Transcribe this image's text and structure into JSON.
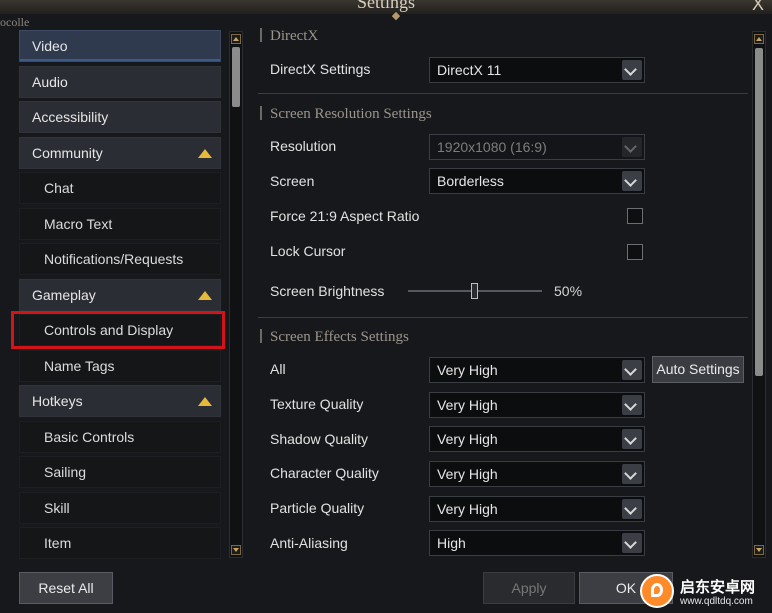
{
  "window": {
    "title": "Settings",
    "close": "X",
    "top_left_text": "ocolle"
  },
  "sidebar": {
    "items": [
      {
        "label": "Video"
      },
      {
        "label": "Audio"
      },
      {
        "label": "Accessibility"
      },
      {
        "label": "Community"
      },
      {
        "label": "Chat"
      },
      {
        "label": "Macro Text"
      },
      {
        "label": "Notifications/Requests"
      },
      {
        "label": "Gameplay"
      },
      {
        "label": "Controls and Display"
      },
      {
        "label": "Name Tags"
      },
      {
        "label": "Hotkeys"
      },
      {
        "label": "Basic Controls"
      },
      {
        "label": "Sailing"
      },
      {
        "label": "Skill"
      },
      {
        "label": "Item"
      }
    ],
    "active": "Video",
    "highlighted": "Controls and Display"
  },
  "directx": {
    "section_title": "DirectX",
    "settings_label": "DirectX Settings",
    "settings_value": "DirectX 11"
  },
  "resolution": {
    "section_title": "Screen Resolution Settings",
    "resolution_label": "Resolution",
    "resolution_value": "1920x1080 (16:9)",
    "screen_label": "Screen",
    "screen_value": "Borderless",
    "aspect_label": "Force 21:9 Aspect Ratio",
    "aspect_checked": false,
    "lock_label": "Lock Cursor",
    "lock_checked": false,
    "brightness_label": "Screen Brightness",
    "brightness_value": "50%",
    "brightness_level": 0.5
  },
  "effects": {
    "section_title": "Screen Effects Settings",
    "auto_button": "Auto Settings",
    "rows": [
      {
        "label": "All",
        "value": "Very High"
      },
      {
        "label": "Texture Quality",
        "value": "Very High"
      },
      {
        "label": "Shadow Quality",
        "value": "Very High"
      },
      {
        "label": "Character Quality",
        "value": "Very High"
      },
      {
        "label": "Particle Quality",
        "value": "Very High"
      },
      {
        "label": "Anti-Aliasing",
        "value": "High"
      }
    ]
  },
  "buttons": {
    "reset": "Reset All",
    "apply": "Apply",
    "ok": "OK"
  },
  "watermark": {
    "title": "启东安卓网",
    "url": "www.qdltdq.com"
  },
  "colors": {
    "accent": "#e6b93a",
    "highlight_box": "#d1131a",
    "active_nav": "#2f3a4e"
  }
}
